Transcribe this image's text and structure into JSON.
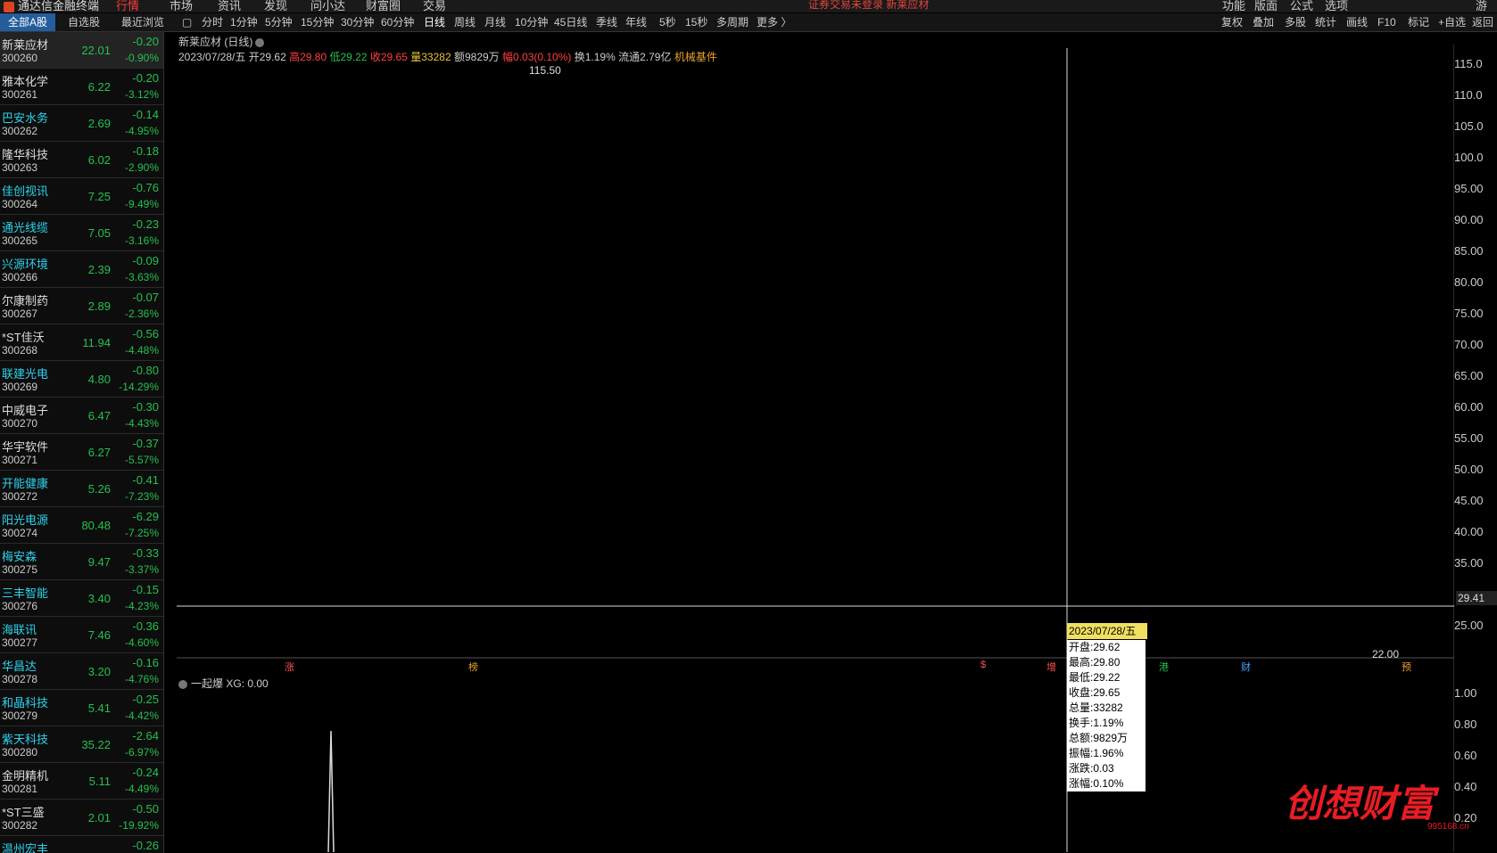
{
  "app": {
    "title": "通达信金融终端"
  },
  "menu": [
    {
      "label": "行情",
      "active": true
    },
    {
      "label": "市场",
      "active": false
    },
    {
      "label": "资讯",
      "active": false
    },
    {
      "label": "发现",
      "active": false
    },
    {
      "label": "问小达",
      "active": false
    },
    {
      "label": "财富圈",
      "active": false
    },
    {
      "label": "交易",
      "active": false
    }
  ],
  "top_notice": "证券交易未登录   新莱应材",
  "top_right": [
    "功能",
    "版面",
    "公式",
    "选项"
  ],
  "top_right_end": "游客",
  "list_tabs": [
    {
      "label": "全部A股",
      "active": true
    },
    {
      "label": "自选股",
      "active": false
    },
    {
      "label": "最近浏览",
      "active": false
    }
  ],
  "periods": [
    {
      "label": "分时",
      "active": false
    },
    {
      "label": "1分钟",
      "active": false
    },
    {
      "label": "5分钟",
      "active": false
    },
    {
      "label": "15分钟",
      "active": false
    },
    {
      "label": "30分钟",
      "active": false
    },
    {
      "label": "60分钟",
      "active": false
    },
    {
      "label": "日线",
      "active": true
    },
    {
      "label": "周线",
      "active": false
    },
    {
      "label": "月线",
      "active": false
    },
    {
      "label": "10分钟",
      "active": false
    },
    {
      "label": "45日线",
      "active": false
    },
    {
      "label": "季线",
      "active": false
    },
    {
      "label": "年线",
      "active": false
    },
    {
      "label": "5秒",
      "active": false
    },
    {
      "label": "15秒",
      "active": false
    },
    {
      "label": "多周期",
      "active": false
    },
    {
      "label": "更多 〉",
      "active": false
    }
  ],
  "tools": [
    "复权",
    "叠加",
    "多股",
    "统计",
    "画线",
    "F10",
    "标记",
    "+自选",
    "返回"
  ],
  "stocks": [
    {
      "name": "新莱应材",
      "code": "300260",
      "price": "22.01",
      "chg": "-0.20",
      "pct": "-0.90%",
      "hl": false,
      "selected": true
    },
    {
      "name": "雅本化学",
      "code": "300261",
      "price": "6.22",
      "chg": "-0.20",
      "pct": "-3.12%",
      "hl": false,
      "selected": false
    },
    {
      "name": "巴安水务",
      "code": "300262",
      "price": "2.69",
      "chg": "-0.14",
      "pct": "-4.95%",
      "hl": true,
      "selected": false
    },
    {
      "name": "隆华科技",
      "code": "300263",
      "price": "6.02",
      "chg": "-0.18",
      "pct": "-2.90%",
      "hl": false,
      "selected": false
    },
    {
      "name": "佳创视讯",
      "code": "300264",
      "price": "7.25",
      "chg": "-0.76",
      "pct": "-9.49%",
      "hl": true,
      "selected": false
    },
    {
      "name": "通光线缆",
      "code": "300265",
      "price": "7.05",
      "chg": "-0.23",
      "pct": "-3.16%",
      "hl": true,
      "selected": false
    },
    {
      "name": "兴源环境",
      "code": "300266",
      "price": "2.39",
      "chg": "-0.09",
      "pct": "-3.63%",
      "hl": true,
      "selected": false
    },
    {
      "name": "尔康制药",
      "code": "300267",
      "price": "2.89",
      "chg": "-0.07",
      "pct": "-2.36%",
      "hl": false,
      "selected": false
    },
    {
      "name": "*ST佳沃",
      "code": "300268",
      "price": "11.94",
      "chg": "-0.56",
      "pct": "-4.48%",
      "hl": false,
      "selected": false
    },
    {
      "name": "联建光电",
      "code": "300269",
      "price": "4.80",
      "chg": "-0.80",
      "pct": "-14.29%",
      "hl": true,
      "selected": false
    },
    {
      "name": "中威电子",
      "code": "300270",
      "price": "6.47",
      "chg": "-0.30",
      "pct": "-4.43%",
      "hl": false,
      "selected": false
    },
    {
      "name": "华宇软件",
      "code": "300271",
      "price": "6.27",
      "chg": "-0.37",
      "pct": "-5.57%",
      "hl": false,
      "selected": false
    },
    {
      "name": "开能健康",
      "code": "300272",
      "price": "5.26",
      "chg": "-0.41",
      "pct": "-7.23%",
      "hl": true,
      "selected": false
    },
    {
      "name": "阳光电源",
      "code": "300274",
      "price": "80.48",
      "chg": "-6.29",
      "pct": "-7.25%",
      "hl": true,
      "selected": false
    },
    {
      "name": "梅安森",
      "code": "300275",
      "price": "9.47",
      "chg": "-0.33",
      "pct": "-3.37%",
      "hl": true,
      "selected": false
    },
    {
      "name": "三丰智能",
      "code": "300276",
      "price": "3.40",
      "chg": "-0.15",
      "pct": "-4.23%",
      "hl": true,
      "selected": false
    },
    {
      "name": "海联讯",
      "code": "300277",
      "price": "7.46",
      "chg": "-0.36",
      "pct": "-4.60%",
      "hl": true,
      "selected": false
    },
    {
      "name": "华昌达",
      "code": "300278",
      "price": "3.20",
      "chg": "-0.16",
      "pct": "-4.76%",
      "hl": true,
      "selected": false
    },
    {
      "name": "和晶科技",
      "code": "300279",
      "price": "5.41",
      "chg": "-0.25",
      "pct": "-4.42%",
      "hl": true,
      "selected": false
    },
    {
      "name": "紫天科技",
      "code": "300280",
      "price": "35.22",
      "chg": "-2.64",
      "pct": "-6.97%",
      "hl": true,
      "selected": false
    },
    {
      "name": "金明精机",
      "code": "300281",
      "price": "5.11",
      "chg": "-0.24",
      "pct": "-4.49%",
      "hl": false,
      "selected": false
    },
    {
      "name": "*ST三盛",
      "code": "300282",
      "price": "2.01",
      "chg": "-0.50",
      "pct": "-19.92%",
      "hl": false,
      "selected": false
    },
    {
      "name": "温州宏丰",
      "code": "",
      "price": "",
      "chg": "-0.26",
      "pct": "",
      "hl": true,
      "selected": false
    }
  ],
  "chart": {
    "title": "新莱应材 (日线)",
    "info": {
      "date": "2023/07/28/五",
      "open": "开29.62",
      "high": "高29.80",
      "low": "低29.22",
      "close": "收29.65",
      "vol": "量33282",
      "amt": "额9829万",
      "amp": "幅0.03(0.10%)",
      "turn": "换1.19%",
      "float": "流通2.79亿",
      "industry": "机械基件"
    },
    "high_label": "115.50",
    "low_label": "22.00",
    "cursor_price": "29.41",
    "signals": [
      {
        "label": "涨",
        "color": "#ff5050"
      },
      {
        "label": "榜",
        "color": "#e8a030"
      },
      {
        "label": "$",
        "color": "#ff5050"
      },
      {
        "label": "增",
        "color": "#ff5050"
      },
      {
        "label": "港",
        "color": "#26c04f"
      },
      {
        "label": "财",
        "color": "#4aa3ff"
      },
      {
        "label": "预",
        "color": "#e8a030"
      }
    ],
    "tooltip": {
      "date": "2023/07/28/五",
      "lines": [
        "开盘:29.62",
        "最高:29.80",
        "最低:29.22",
        "收盘:29.65",
        "总量:33282",
        "换手:1.19%",
        "总额:9829万",
        "振幅:1.96%",
        "涨跌:0.03",
        "涨幅:0.10%"
      ]
    },
    "axis_main": [
      "115.0",
      "110.0",
      "105.0",
      "100.0",
      "95.00",
      "90.00",
      "85.00",
      "80.00",
      "75.00",
      "70.00",
      "65.00",
      "60.00",
      "55.00",
      "50.00",
      "45.00",
      "40.00",
      "35.00",
      "25.00"
    ],
    "axis_sub": [
      "1.00",
      "0.80",
      "0.60",
      "0.40",
      "0.20"
    ]
  },
  "sub_indicator": {
    "name": "一起爆",
    "value": "XG: 0.00"
  },
  "watermark": {
    "text": "创想财富",
    "url": "995168.cn"
  }
}
